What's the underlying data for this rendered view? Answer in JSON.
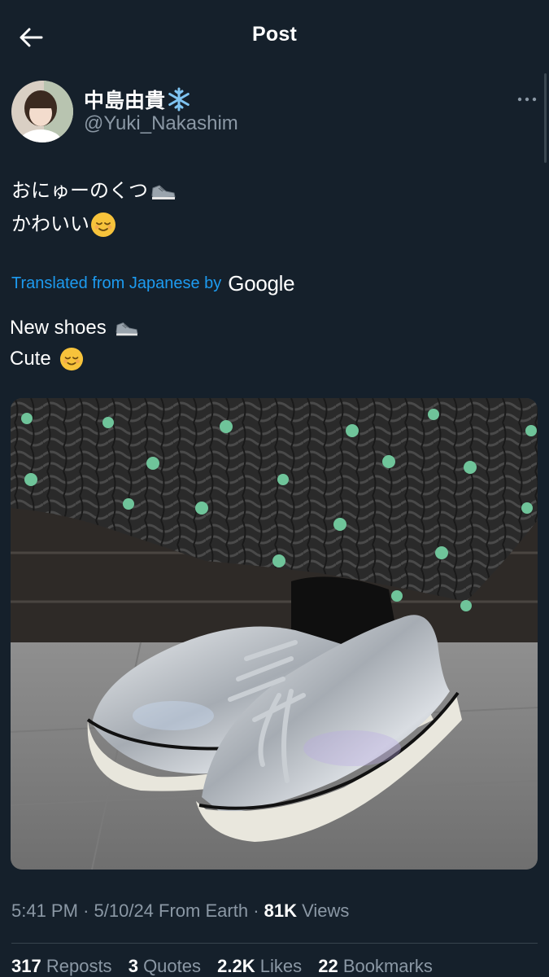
{
  "header": {
    "title": "Post",
    "back_icon": "arrow-left-icon"
  },
  "author": {
    "name": "中島由貴",
    "name_emoji": "snowflake-icon",
    "handle": "@Yuki_Nakashim",
    "more_icon": "more-horizontal-icon"
  },
  "post": {
    "line1": "おにゅーのくつ",
    "line1_emoji": "sneaker-icon",
    "line2": "かわいい",
    "line2_emoji": "relieved-face-icon"
  },
  "translation": {
    "label": "Translated from Japanese by",
    "provider": "Google",
    "line1": "New shoes",
    "line1_emoji": "sneaker-icon",
    "line2": "Cute",
    "line2_emoji": "relieved-face-icon"
  },
  "media": {
    "subject": "silver-sneakers-photo"
  },
  "meta": {
    "time": "5:41 PM",
    "date": "5/10/24",
    "source": "From Earth",
    "views_count": "81K",
    "views_label": "Views"
  },
  "stats": {
    "reposts_count": "317",
    "reposts_label": "Reposts",
    "quotes_count": "3",
    "quotes_label": "Quotes",
    "likes_count": "2.2K",
    "likes_label": "Likes",
    "bookmarks_count": "22",
    "bookmarks_label": "Bookmarks"
  },
  "colors": {
    "background": "#15202b",
    "link": "#1d9bf0",
    "secondary_text": "#8b98a5"
  }
}
